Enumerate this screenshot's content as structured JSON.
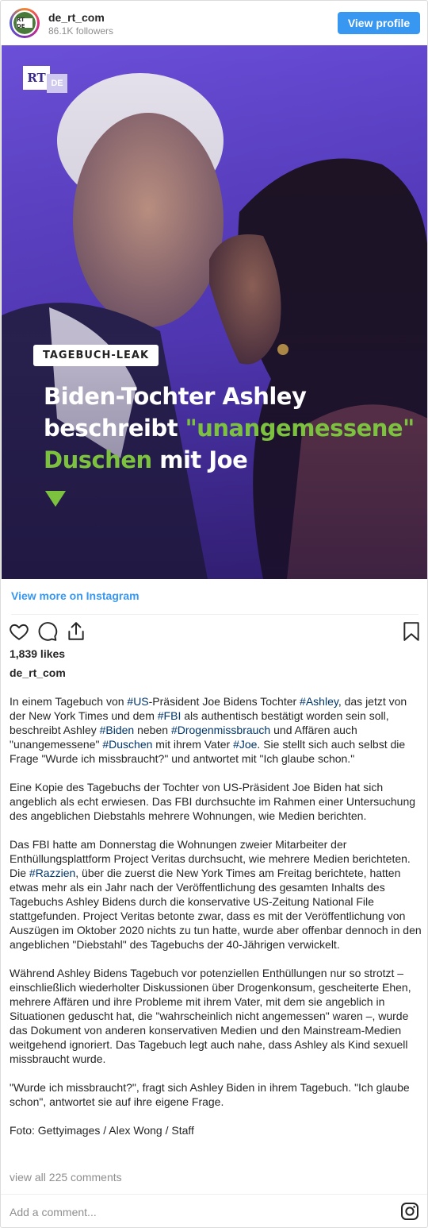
{
  "header": {
    "username": "de_rt_com",
    "followers": "86.1K followers",
    "view_profile_label": "View profile",
    "avatar_logo": "RT DE"
  },
  "image": {
    "logo_rt": "RT",
    "logo_de": "DE",
    "tag": "TAGEBUCH-LEAK",
    "headline_line1": "Biden-Tochter Ashley",
    "headline_line2_plain": "beschreibt ",
    "headline_line2_green": "\"unangemessene\"",
    "headline_line3_green": "Duschen",
    "headline_line3_plain": " mit Joe",
    "colors": {
      "background": "#5b3fc8",
      "accent_green": "#7cc23f"
    }
  },
  "view_more_label": "View more on Instagram",
  "actions": {
    "like_icon": "heart-icon",
    "comment_icon": "comment-icon",
    "share_icon": "share-icon",
    "save_icon": "bookmark-icon"
  },
  "likes": "1,839 likes",
  "owner": "de_rt_com",
  "caption": {
    "p1": [
      {
        "t": "In einem Tagebuch von "
      },
      {
        "t": "#US",
        "tag": true
      },
      {
        "t": "-Präsident Joe Bidens Tochter "
      },
      {
        "t": "#Ashley",
        "tag": true
      },
      {
        "t": ", das jetzt von der New York Times und dem "
      },
      {
        "t": "#FBI",
        "tag": true
      },
      {
        "t": " als authentisch bestätigt worden sein soll, beschreibt Ashley "
      },
      {
        "t": "#Biden",
        "tag": true
      },
      {
        "t": " neben "
      },
      {
        "t": "#Drogenmissbrauch",
        "tag": true
      },
      {
        "t": " und Affären auch \"unangemessene\" "
      },
      {
        "t": "#Duschen",
        "tag": true
      },
      {
        "t": " mit ihrem Vater "
      },
      {
        "t": "#Joe",
        "tag": true
      },
      {
        "t": ". Sie stellt sich auch selbst die Frage \"Wurde ich missbraucht?\" und antwortet mit \"Ich glaube schon.\""
      }
    ],
    "p2": "Eine Kopie des Tagebuchs der Tochter von US-Präsident Joe Biden hat sich angeblich als echt erwiesen. Das FBI durchsuchte im Rahmen einer Untersuchung des angeblichen Diebstahls mehrere Wohnungen, wie Medien berichten.",
    "p3": [
      {
        "t": "Das FBI hatte am Donnerstag die Wohnungen zweier Mitarbeiter der Enthüllungsplattform Project Veritas durchsucht, wie mehrere Medien berichteten. Die "
      },
      {
        "t": "#Razzien",
        "tag": true
      },
      {
        "t": ", über die zuerst die New York Times am Freitag berichtete, hatten etwas mehr als ein Jahr nach der Veröffentlichung des gesamten Inhalts des Tagebuchs Ashley Bidens durch die konservative US-Zeitung National File stattgefunden. Project Veritas betonte zwar, dass es mit der Veröffentlichung von Auszügen im Oktober 2020 nichts zu tun hatte, wurde aber offenbar dennoch in den angeblichen \"Diebstahl\" des Tagebuchs der 40-Jährigen verwickelt."
      }
    ],
    "p4": "Während Ashley Bidens Tagebuch vor potenziellen Enthüllungen nur so strotzt – einschließlich wiederholter Diskussionen über Drogenkonsum, gescheiterte Ehen, mehrere Affären und ihre Probleme mit ihrem Vater, mit dem sie angeblich in Situationen geduscht hat, die \"wahrscheinlich nicht angemessen\" waren –, wurde das Dokument von anderen konservativen Medien und den Mainstream-Medien weitgehend ignoriert. Das Tagebuch legt auch nahe, dass Ashley als Kind sexuell missbraucht wurde.",
    "p5": "\"Wurde ich missbraucht?\", fragt sich Ashley Biden in ihrem Tagebuch. \"Ich glaube schon\", antwortet sie auf ihre eigene Frage.",
    "p6": "Foto: Gettyimages / Alex Wong / Staff"
  },
  "view_comments_label": "view all 225 comments",
  "add_comment_placeholder": "Add a comment...",
  "instagram_icon": "instagram-icon"
}
